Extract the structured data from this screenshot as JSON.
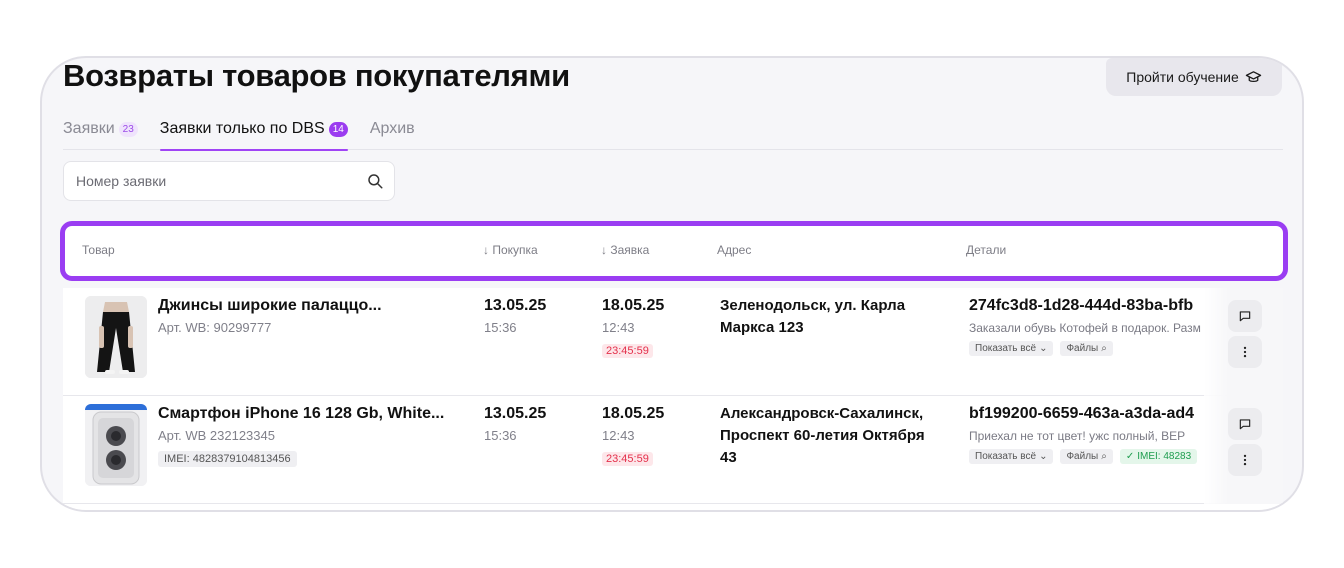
{
  "page": {
    "title": "Возвраты товаров покупателями",
    "learn_button": "Пройти обучение"
  },
  "tabs": [
    {
      "label": "Заявки",
      "badge": "23"
    },
    {
      "label": "Заявки только по DBS",
      "badge": "14"
    },
    {
      "label": "Архив",
      "badge": ""
    }
  ],
  "search": {
    "placeholder": "Номер заявки"
  },
  "columns": {
    "product": "Товар",
    "purchase": "↓ Покупка",
    "request": "↓ Заявка",
    "address": "Адрес",
    "details": "Детали"
  },
  "rows": [
    {
      "name": "Джинсы широкие палаццо...",
      "article": "Арт. WB: 90299777",
      "imei": "",
      "purchase_date": "13.05.25",
      "purchase_time": "15:36",
      "request_date": "18.05.25",
      "request_time": "12:43",
      "deadline": "23:45:59",
      "address": "Зеленодольск, ул. Карла Маркса 123",
      "order_id": "274fc3d8-1d28-444d-83ba-bfb",
      "comment": "Заказали обувь Котофей в подарок. Разм",
      "show_all": "Показать всё",
      "files": "Файлы",
      "imei_chip": ""
    },
    {
      "name": "Смартфон iPhone 16 128 Gb, White...",
      "article": "Арт. WB 232123345",
      "imei": "IMEI: 4828379104813456",
      "purchase_date": "13.05.25",
      "purchase_time": "15:36",
      "request_date": "18.05.25",
      "request_time": "12:43",
      "deadline": "23:45:59",
      "address": "Александровск-Сахалинск, Проспект 60-летия Октября 43",
      "order_id": "bf199200-6659-463a-a3da-ad4",
      "comment": "Приехал не тот цвет! ужс полный, ВЕР",
      "show_all": "Показать всё",
      "files": "Файлы",
      "imei_chip": "IMEI: 48283"
    }
  ],
  "colors": {
    "accent": "#9a3df2",
    "deadline": "#e4304b",
    "imei_ok": "#1f9d4f"
  }
}
